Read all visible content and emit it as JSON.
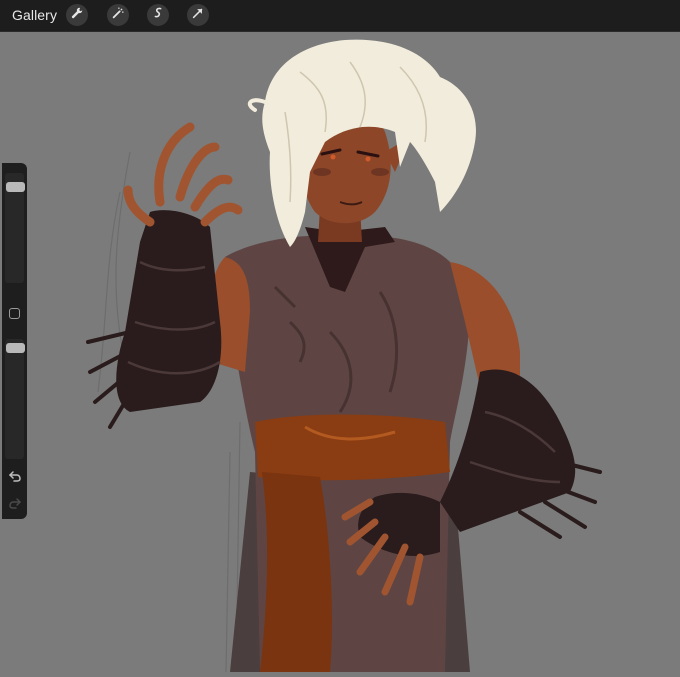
{
  "topbar": {
    "gallery_label": "Gallery",
    "tools": [
      {
        "name": "wrench-icon"
      },
      {
        "name": "magic-wand-icon"
      },
      {
        "name": "selection-icon"
      },
      {
        "name": "transform-arrow-icon"
      }
    ]
  },
  "sidebar": {
    "brush_size_level": 0.92,
    "opacity_level": 0.95,
    "icons": [
      "modifier-square-icon",
      "undo-icon",
      "redo-icon"
    ]
  },
  "colors": {
    "topbar": "#1d1d1d",
    "canvas_bg": "#7b7b7b",
    "hair": "#f2ecdc",
    "skin": "#9a4e2c",
    "tunic": "#5e4543",
    "sash": "#8a3c12",
    "gloves": "#2a1c1c"
  }
}
